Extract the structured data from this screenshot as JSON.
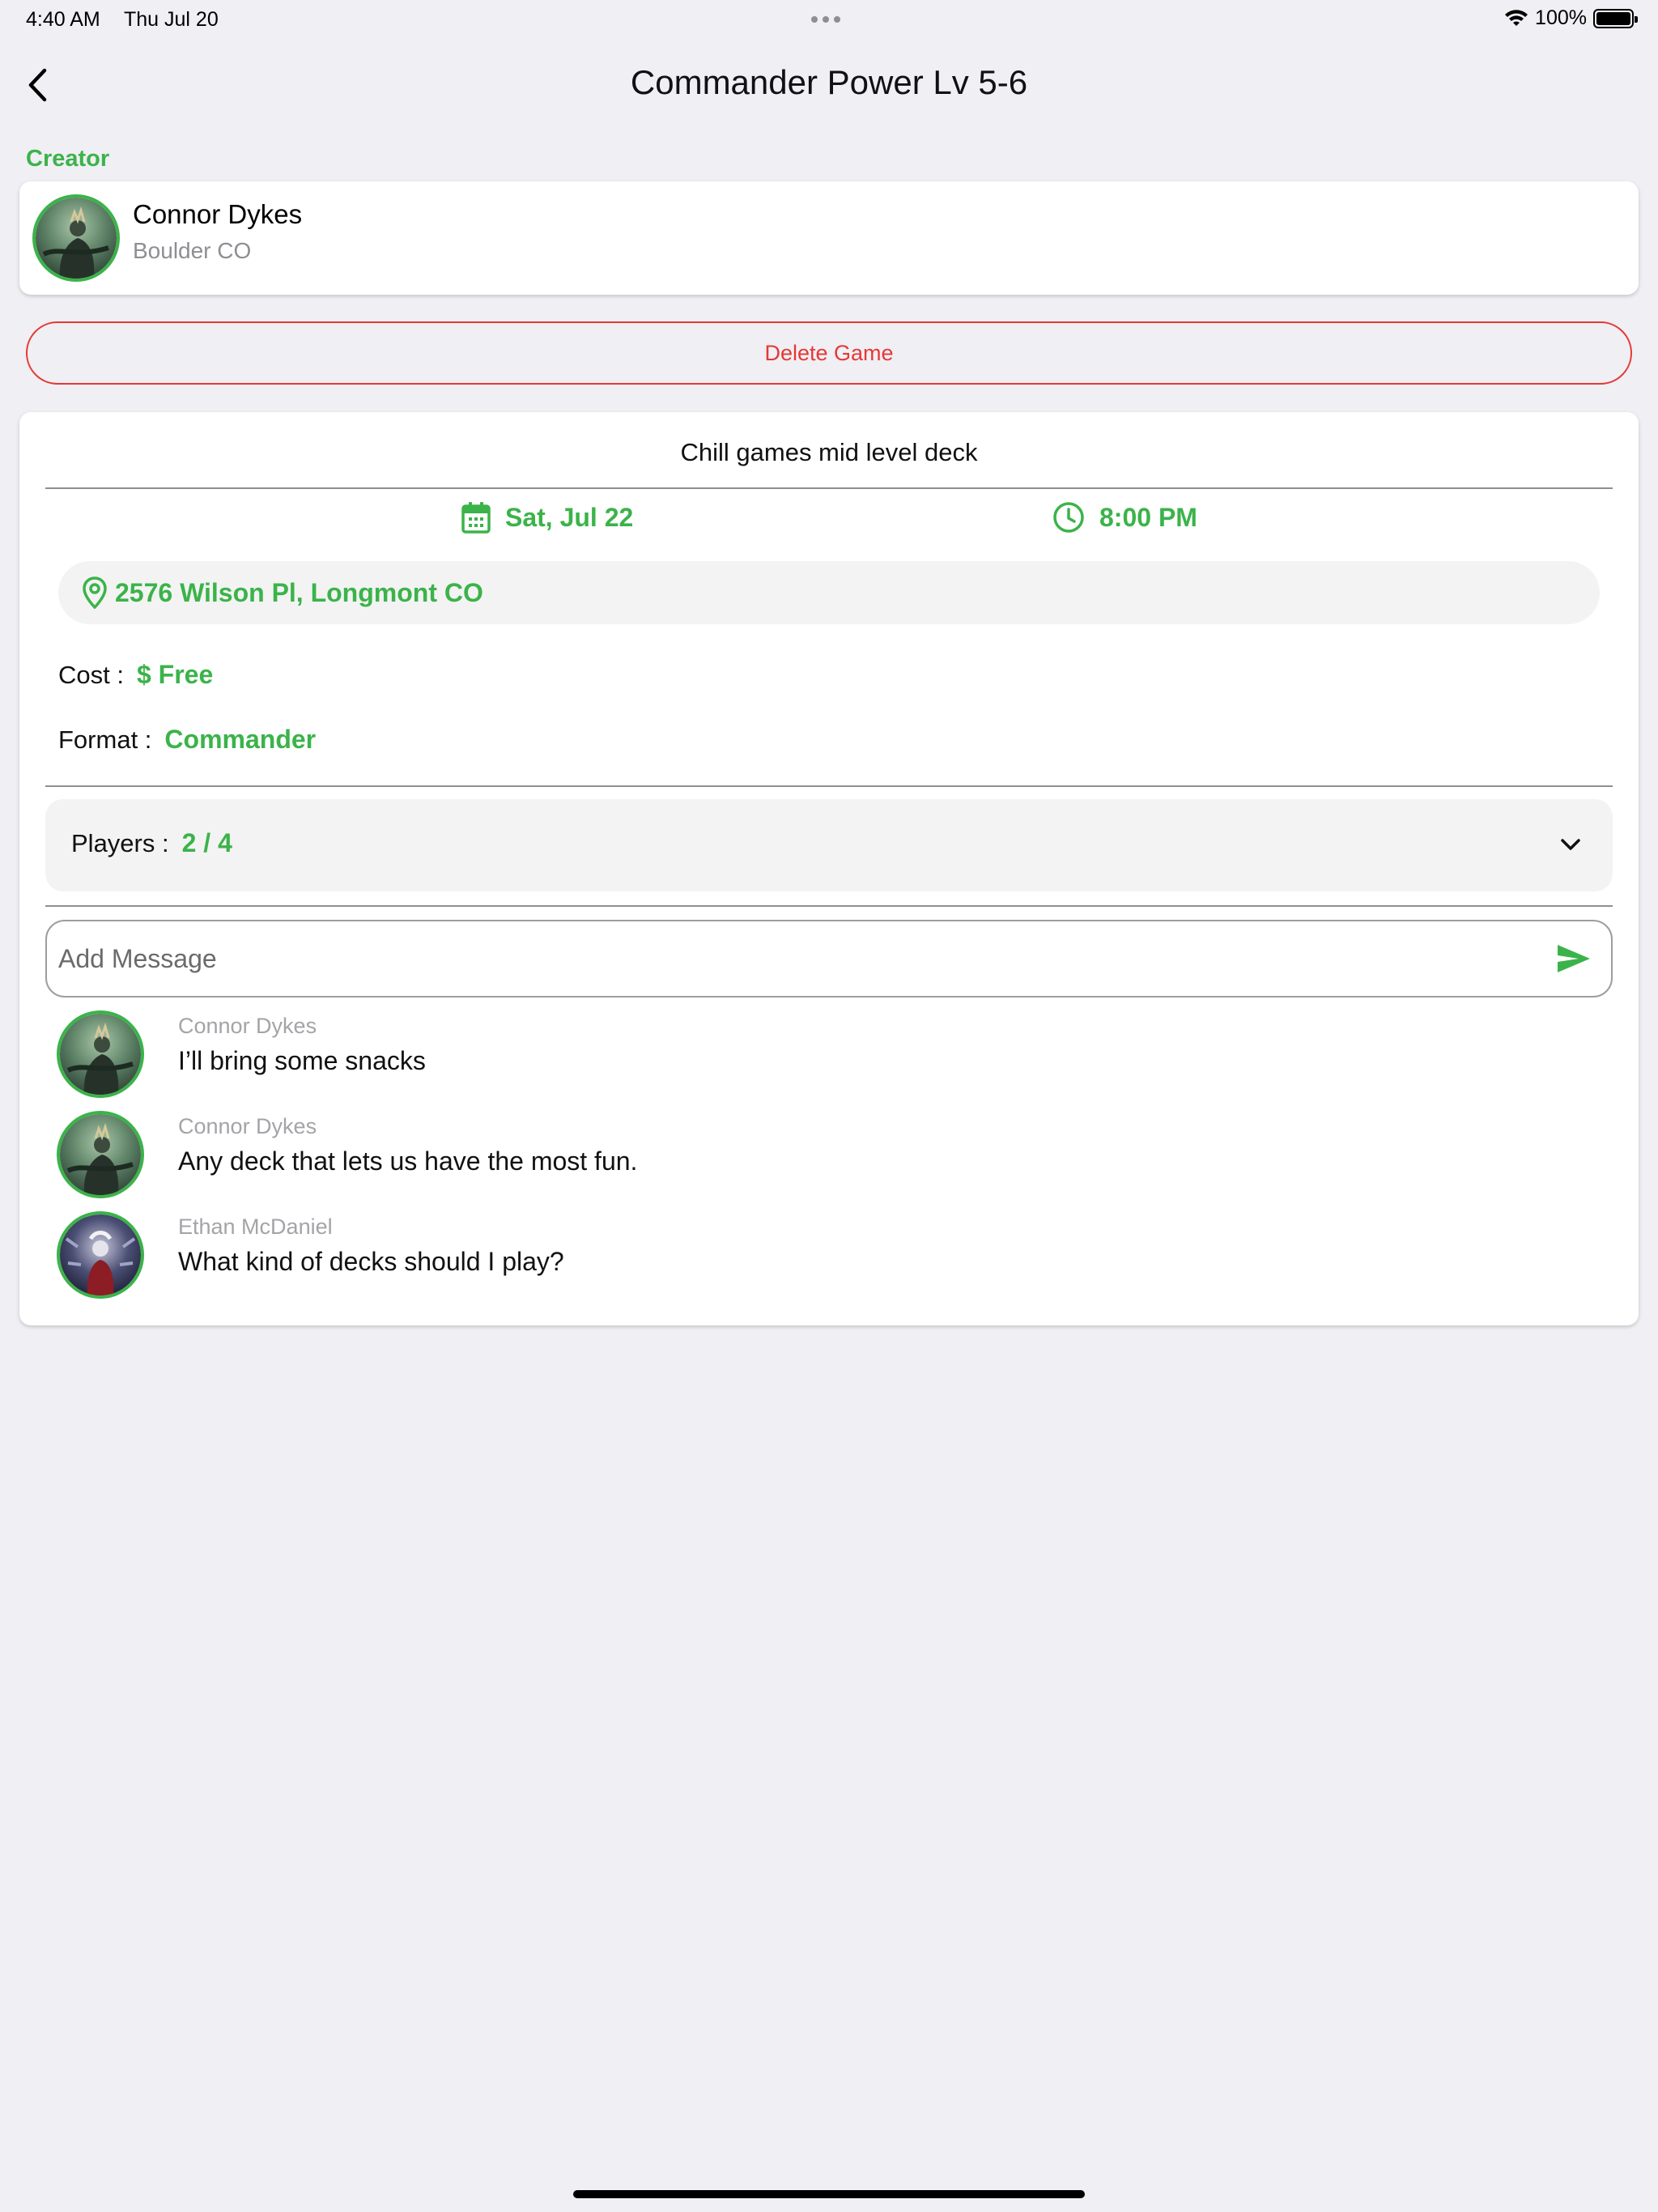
{
  "status_bar": {
    "time": "4:40 AM",
    "date": "Thu Jul 20",
    "battery": "100%",
    "battery_level": 1.0
  },
  "header": {
    "back_icon": "chevron-left-icon",
    "title": "Commander Power Lv 5-6"
  },
  "creator": {
    "section_label": "Creator",
    "name": "Connor Dykes",
    "location": "Boulder CO"
  },
  "delete_button": {
    "label": "Delete Game"
  },
  "game": {
    "description": "Chill games mid level deck",
    "date": "Sat, Jul 22",
    "time": "8:00 PM",
    "address": "2576 Wilson Pl, Longmont CO",
    "cost_label": "Cost :",
    "cost_value": "$ Free",
    "format_label": "Format :",
    "format_value": "Commander",
    "players_label": "Players :",
    "players_value": "2 / 4"
  },
  "message_input": {
    "placeholder": "Add Message"
  },
  "messages": [
    {
      "author": "Connor Dykes",
      "text": "I’ll bring some snacks",
      "avatar": "commander-art-1"
    },
    {
      "author": "Connor Dykes",
      "text": "Any deck that lets us have the most fun.",
      "avatar": "commander-art-1"
    },
    {
      "author": "Ethan  McDaniel",
      "text": "What kind of decks should I play?",
      "avatar": "commander-art-2"
    }
  ],
  "colors": {
    "accent": "#3bb34a",
    "danger": "#e53935",
    "background": "#efeff4",
    "card": "#ffffff",
    "muted": "#8e8e93"
  }
}
